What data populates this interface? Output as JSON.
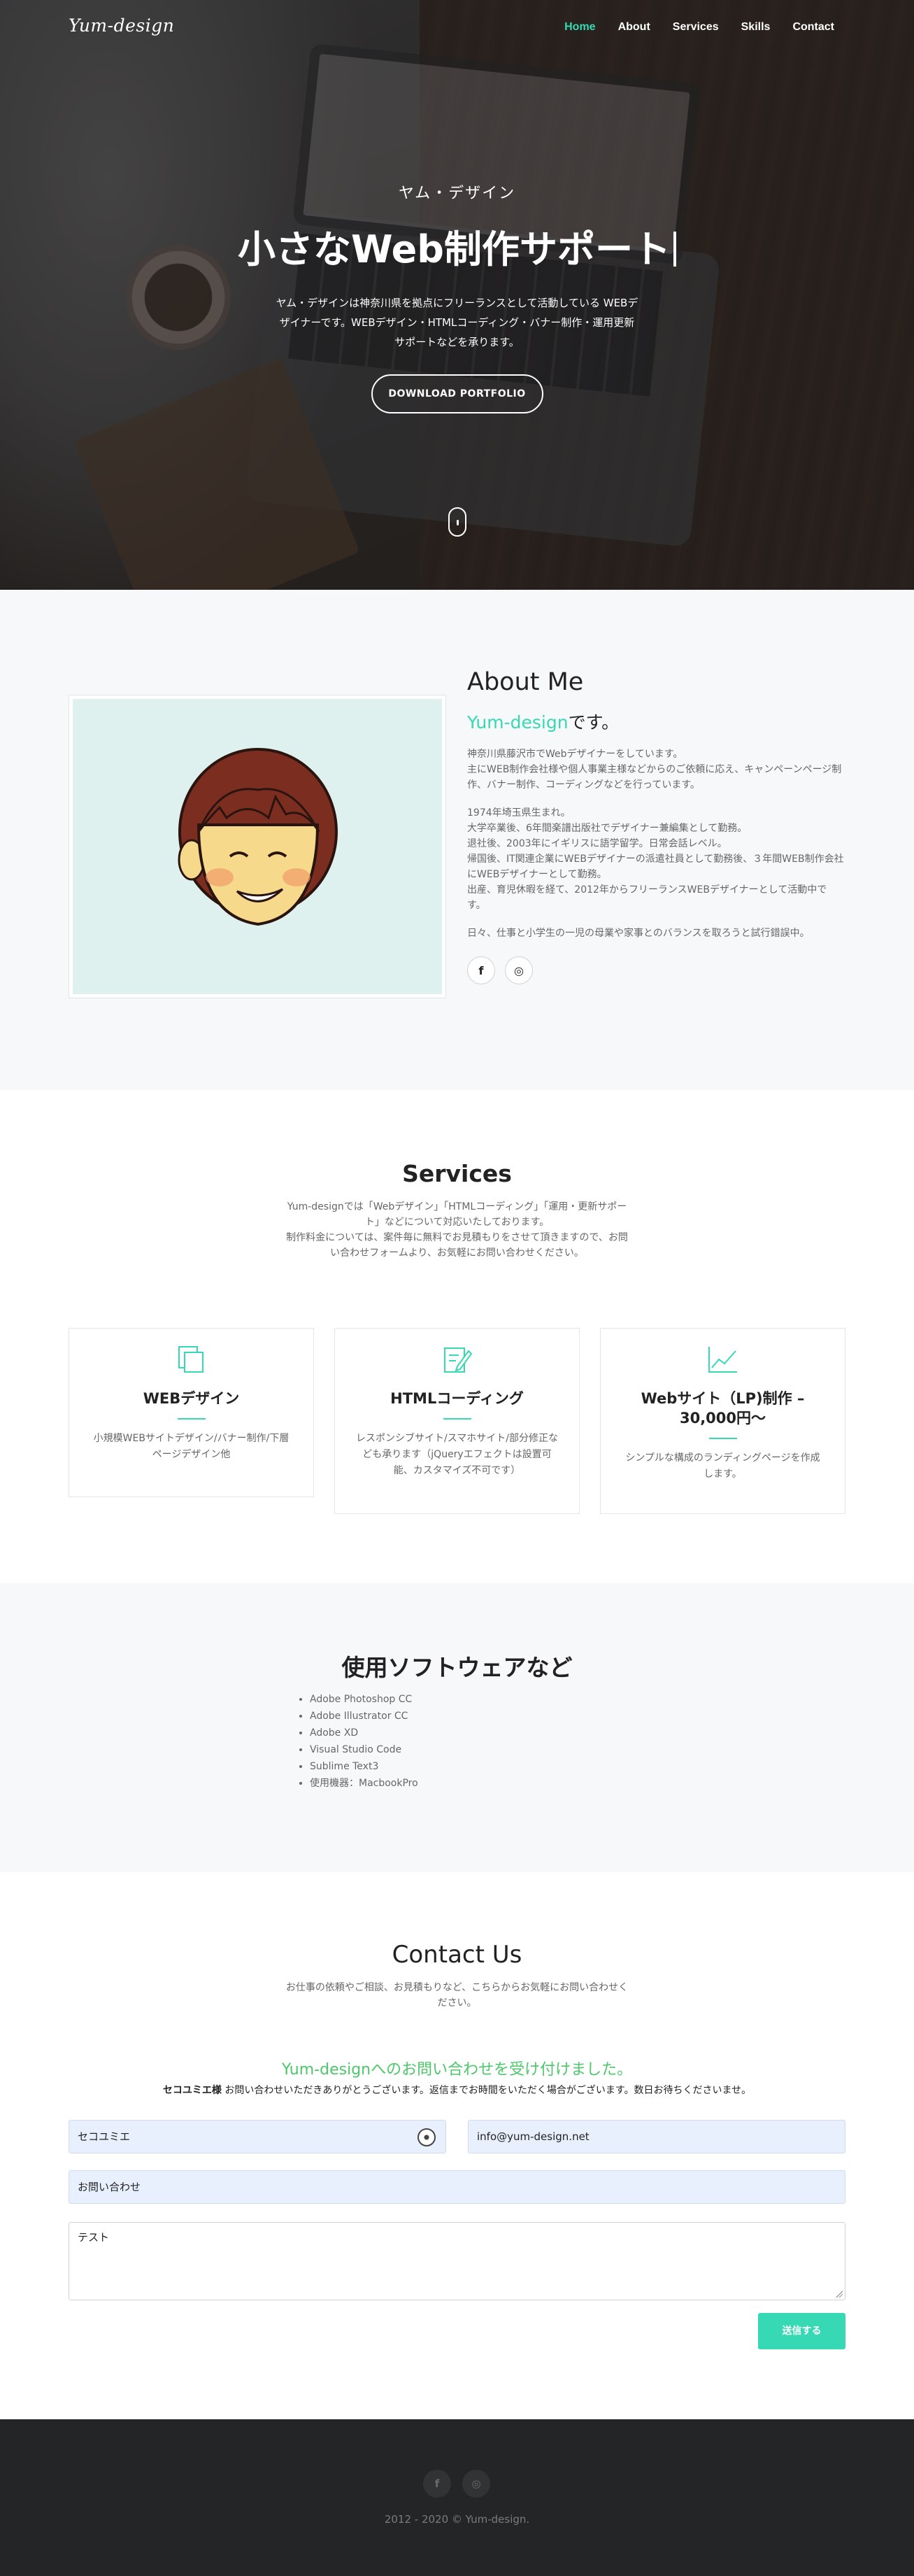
{
  "nav": {
    "logo": "Yum-design",
    "items": [
      {
        "label": "Home",
        "active": true
      },
      {
        "label": "About",
        "active": false
      },
      {
        "label": "Services",
        "active": false
      },
      {
        "label": "Skills",
        "active": false
      },
      {
        "label": "Contact",
        "active": false
      }
    ]
  },
  "hero": {
    "subtitle": "ヤム・デザイン",
    "title": "小さなWeb制作サポート",
    "description": "ヤム・デザインは神奈川県を拠点にフリーランスとして活動している WEBデザイナーです。WEBデザイン・HTMLコーディング・バナー制作・運用更新サポートなどを承ります。",
    "button": "DOWNLOAD PORTFOLIO"
  },
  "about": {
    "title_a": "About",
    "title_b": " Me",
    "name_accent": "Yum-design",
    "name_suffix": "です。",
    "p1": "神奈川県藤沢市でWebデザイナーをしています。\n主にWEB制作会社様や個人事業主様などからのご依頼に応え、キャンペーンページ制作、バナー制作、コーディングなどを行っています。",
    "p2": "1974年埼玉県生まれ。\n大学卒業後、6年間楽譜出版社でデザイナー兼編集として勤務。\n退社後、2003年にイギリスに語学留学。日常会話レベル。\n帰国後、IT関連企業にWEBデザイナーの派遣社員として勤務後、３年間WEB制作会社にWEBデザイナーとして勤務。\n出産、育児休暇を経て、2012年からフリーランスWEBデザイナーとして活動中です。",
    "p3": "日々、仕事と小学生の一児の母業や家事とのバランスを取ろうと試行錯誤中。",
    "social_facebook": "f",
    "social_instagram": "◎"
  },
  "services": {
    "title": "Services",
    "description": "Yum-designでは「Webデザイン」「HTMLコーディング」「運用・更新サポート」などについて対応いたしております。\n制作料金については、案件毎に無料でお見積もりをさせて頂きますので、お問い合わせフォームより、お気軽にお問い合わせください。",
    "cards": [
      {
        "icon": "copy-icon",
        "title": "WEBデザイン",
        "text": "小規模WEBサイトデザイン/バナー制作/下層ページデザイン他"
      },
      {
        "icon": "edit-icon",
        "title": "HTMLコーディング",
        "text": "レスポンシブサイト/スマホサイト/部分修正なども承ります（jQueryエフェクトは設置可能、カスタマイズ不可です）"
      },
      {
        "icon": "chart-icon",
        "title": "Webサイト（LP)制作 – 30,000円〜",
        "text": "シンプルな構成のランディングページを作成します。"
      }
    ]
  },
  "skills": {
    "title": "使用ソフトウェアなど",
    "items": [
      "Adobe Photoshop CC",
      "Adobe Illustrator CC",
      "Adobe XD",
      "Visual Studio Code",
      "Sublime Text3",
      "使用機器：MacbookPro"
    ]
  },
  "contact": {
    "title_a": "Contact",
    "title_b": " Us",
    "description": "お仕事の依頼やご相談、お見積もりなど、こちらからお気軽にお問い合わせください。",
    "thanks": "Yum-designへのお問い合わせを受け付けました。",
    "thanks_name": "セコユミエ様",
    "thanks_message": " お問い合わせいただきありがとうございます。返信までお時間をいただく場合がございます。数日お待ちくださいませ。",
    "name_value": "セコユミエ",
    "email_value": "info@yum-design.net",
    "subject_value": "お問い合わせ",
    "message_value": "テスト",
    "submit": "送信する"
  },
  "footer": {
    "facebook": "f",
    "instagram": "◎",
    "copyright": "2012 - 2020 © Yum-design."
  },
  "colors": {
    "accent": "#36d9b4",
    "success": "#4cc86a",
    "footer_bg": "#242527",
    "section_bg": "#f7f8fa"
  }
}
